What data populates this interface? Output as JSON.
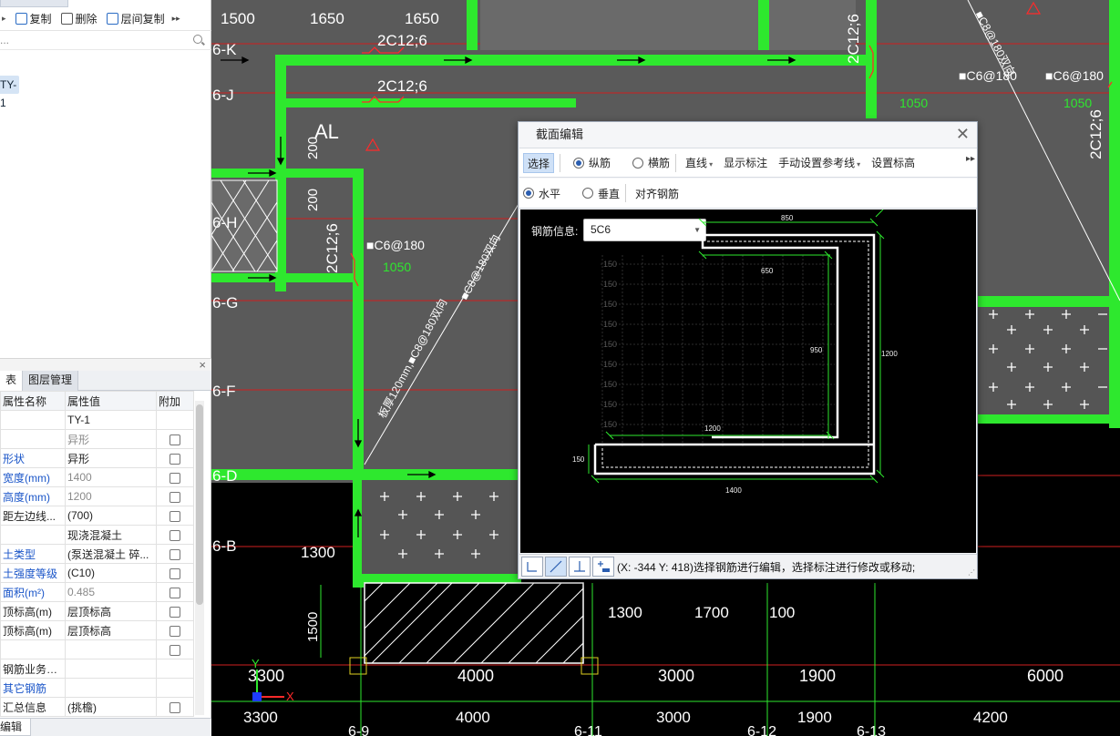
{
  "left_panel": {
    "toolbar": {
      "copy": "复制",
      "delete": "删除",
      "layer_copy": "层间复制"
    },
    "search_placeholder": "...",
    "tree_selected": "TY-1",
    "tabs": [
      "表",
      "图层管理"
    ],
    "table_headers": {
      "name": "属性名称",
      "value": "属性值",
      "extra": "附加"
    },
    "rows": [
      {
        "name": "",
        "value": "TY-1",
        "blue": false,
        "gray": false,
        "checkbox": false
      },
      {
        "name": "",
        "value": "异形",
        "blue": false,
        "gray": true,
        "checkbox": true
      },
      {
        "name": "形状",
        "value": "异形",
        "blue": true,
        "gray": false,
        "checkbox": true
      },
      {
        "name": "宽度(mm)",
        "value": "1400",
        "blue": true,
        "gray": true,
        "checkbox": true
      },
      {
        "name": "高度(mm)",
        "value": "1200",
        "blue": true,
        "gray": true,
        "checkbox": true
      },
      {
        "name": "距左边线...",
        "value": "(700)",
        "blue": false,
        "gray": false,
        "checkbox": true
      },
      {
        "name": "",
        "value": "现浇混凝土",
        "blue": false,
        "gray": false,
        "checkbox": true
      },
      {
        "name": "土类型",
        "value": "(泵送混凝土 碎...",
        "blue": true,
        "gray": false,
        "checkbox": true
      },
      {
        "name": "土强度等级",
        "value": "(C10)",
        "blue": true,
        "gray": false,
        "checkbox": true
      },
      {
        "name": "面积(m²)",
        "value": "0.485",
        "blue": true,
        "gray": true,
        "checkbox": true
      },
      {
        "name": "顶标高(m)",
        "value": "层顶标高",
        "blue": false,
        "gray": false,
        "checkbox": true
      },
      {
        "name": "顶标高(m)",
        "value": "层顶标高",
        "blue": false,
        "gray": false,
        "checkbox": true
      },
      {
        "name": "",
        "value": "",
        "blue": false,
        "gray": false,
        "checkbox": true
      },
      {
        "name": "钢筋业务属性",
        "value": "",
        "blue": false,
        "gray": false,
        "checkbox": false
      },
      {
        "name": " 其它钢筋",
        "value": "",
        "blue": true,
        "gray": false,
        "checkbox": false
      },
      {
        "name": " 汇总信息",
        "value": "(挑檐)",
        "blue": false,
        "gray": false,
        "checkbox": true
      }
    ],
    "bottom_tab": "编辑"
  },
  "cad": {
    "top_dims": [
      "1500",
      "1650",
      "1650"
    ],
    "rebar_tags": [
      "2C12;6",
      "2C12;6",
      "2C12;6",
      "2C12;6",
      "2C12;6"
    ],
    "stirrup_tags": [
      "■C6@180",
      "■C6@180",
      "■C6@180"
    ],
    "green_nums": [
      "1050",
      "1050",
      "1050"
    ],
    "row_labels": [
      "6-K",
      "6-J",
      "6-H",
      "6-G",
      "6-F",
      "6-D",
      "6-B"
    ],
    "side_dims": [
      "200",
      "200"
    ],
    "al_label": "AL",
    "diag_texts": [
      "板厚120mm,■C8@180双向",
      "■C8@180双向",
      "■C8@180双向"
    ],
    "dim_1300_left": "1300",
    "dim_1500_left": "1500",
    "lower_dims": [
      "1300",
      "1700",
      "100"
    ],
    "bottom_row1": [
      "3300",
      "4000",
      "3000",
      "1900",
      "6000"
    ],
    "bottom_row2": [
      "3300",
      "4000",
      "3000",
      "1900",
      "4200"
    ],
    "axis_labels": [
      "6-9",
      "6-11",
      "6-12",
      "6-13"
    ],
    "axis_x": "X",
    "axis_y": "Y"
  },
  "dialog": {
    "title": "截面编辑",
    "toolbar1": {
      "select": "选择",
      "longitudinal": "纵筋",
      "transverse": "横筋",
      "line": "直线",
      "show_dims": "显示标注",
      "manual_ref": "手动设置参考线",
      "set_elev": "设置标高"
    },
    "toolbar2": {
      "horizontal": "水平",
      "vertical": "垂直",
      "align": "对齐钢筋"
    },
    "rebar_info_label": "钢筋信息:",
    "rebar_info_value": "5C6",
    "drawing": {
      "dim_850": "850",
      "dim_650": "650",
      "dim_950": "950",
      "dim_1200_right": "1200",
      "dim_1200_inner": "1200",
      "dim_150": "150",
      "dim_1400": "1400",
      "grid_label": "150"
    },
    "status": "(X: -344 Y: 418)选择钢筋进行编辑，选择标注进行修改或移动;"
  }
}
